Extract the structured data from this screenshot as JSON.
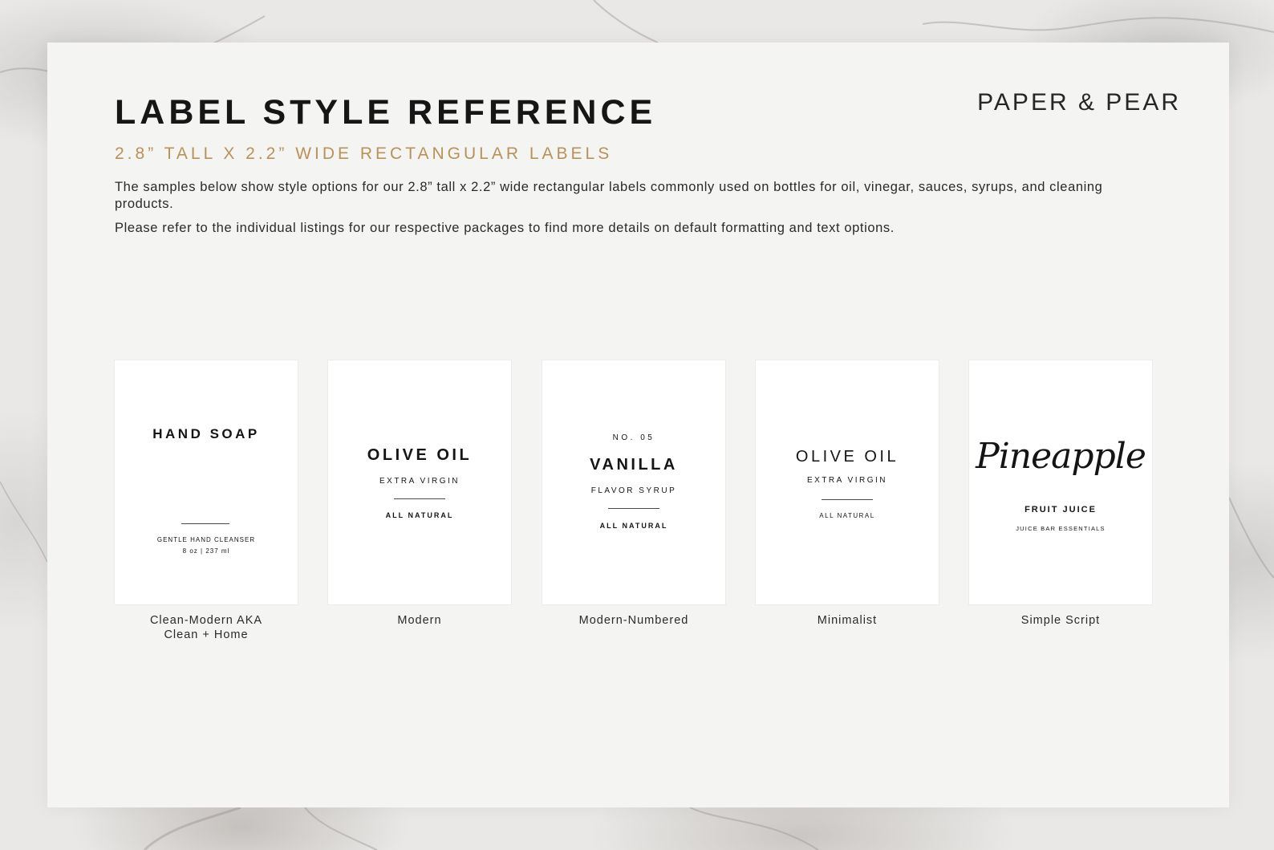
{
  "header": {
    "title": "LABEL STYLE REFERENCE",
    "brand": "PAPER & PEAR",
    "subtitle": "2.8” TALL X 2.2” WIDE RECTANGULAR LABELS",
    "description": "The samples below show style options for our 2.8” tall x 2.2” wide rectangular labels commonly used on bottles for oil, vinegar, sauces, syrups, and cleaning products.",
    "note": "Please refer to the individual listings for our respective packages to find more details on default formatting and text options."
  },
  "colors": {
    "accent": "#b9915a",
    "text": "#161616",
    "card": "#f4f4f3"
  },
  "samples": [
    {
      "caption": "Clean-Modern AKA\nClean + Home",
      "name": "HAND SOAP",
      "line1": "GENTLE HAND CLEANSER",
      "line2": "8 oz | 237 ml"
    },
    {
      "caption": "Modern",
      "name": "OLIVE OIL",
      "sub": "EXTRA VIRGIN",
      "bottom": "ALL NATURAL"
    },
    {
      "caption": "Modern-Numbered",
      "number": "NO. 05",
      "name": "VANILLA",
      "sub": "FLAVOR SYRUP",
      "bottom": "ALL NATURAL"
    },
    {
      "caption": "Minimalist",
      "name": "OLIVE OIL",
      "sub": "EXTRA VIRGIN",
      "bottom": "ALL NATURAL"
    },
    {
      "caption": "Simple Script",
      "name": "Pineapple",
      "sub": "FRUIT JUICE",
      "bottom": "JUICE BAR ESSENTIALS"
    }
  ]
}
